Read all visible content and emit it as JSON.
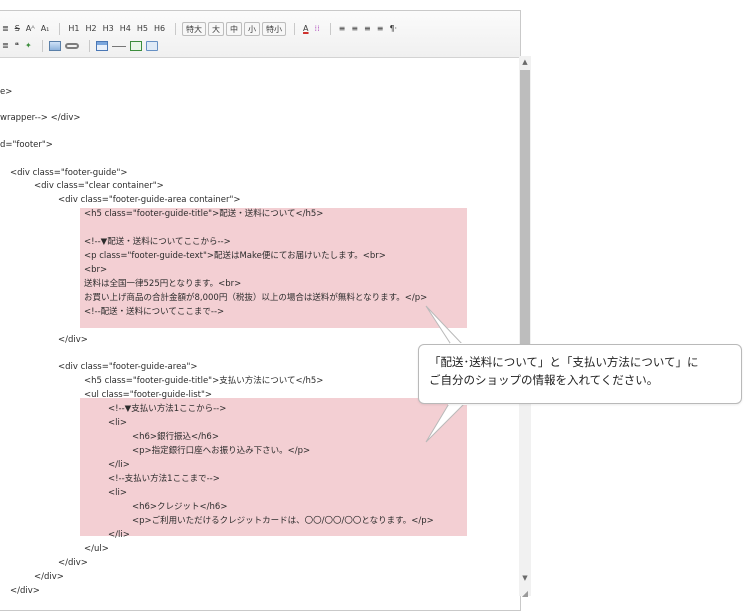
{
  "toolbar": {
    "row1": {
      "format_a": "≣",
      "strike": "S",
      "sup": "Aᴬ",
      "sub": "A₁",
      "headings": [
        "H1",
        "H2",
        "H3",
        "H4",
        "H5",
        "H6"
      ],
      "size_buttons": [
        "特大",
        "大",
        "中",
        "小",
        "特小"
      ],
      "text_color": "A",
      "bg_color": "⁞⁞",
      "align": [
        "≡",
        "≡",
        "≡",
        "≡"
      ],
      "paragraph": "¶·"
    },
    "row2": {
      "list": "≣",
      "quote": "❝",
      "special": "✦"
    },
    "colors": {
      "accent_underline": "#d0312d"
    }
  },
  "code_lines": [
    "e>",
    "wrapper--> </div>",
    "d=\"footer\">",
    "<div class=\"footer-guide\">",
    "<div class=\"clear container\">",
    "<div class=\"footer-guide-area container\">",
    "<h5 class=\"footer-guide-title\">配送・送料について</h5>",
    "<!--▼配送・送料についてここから-->",
    "<p class=\"footer-guide-text\">配送はMake便にてお届けいたします。<br>",
    "<br>",
    "送料は全国一律525円となります。<br>",
    "お買い上げ商品の合計金額が8,000円（税抜）以上の場合は送料が無料となります。</p>",
    "<!--配送・送料についてここまで-->",
    "</div>",
    "<div class=\"footer-guide-area\">",
    "<h5 class=\"footer-guide-title\">支払い方法について</h5>",
    "<ul class=\"footer-guide-list\">",
    "<!--▼支払い方法1ここから-->",
    "<li>",
    "<h6>銀行振込</h6>",
    "<p>指定銀行口座へお振り込み下さい。</p>",
    "</li>",
    "<!--支払い方法1ここまで-->",
    "<li>",
    "<h6>クレジット</h6>",
    "<p>ご利用いただけるクレジットカードは、〇〇/〇〇/〇〇となります。</p>",
    "</li>",
    "</ul>",
    "</div>",
    "</div>",
    "</div>"
  ],
  "callout": {
    "line1": "「配送･送料について」と「支払い方法について」に",
    "line2": "ご自分のショップの情報を入れてください。"
  },
  "scrollbar": {
    "up": "▲",
    "down": "▼",
    "resize": "◢"
  }
}
